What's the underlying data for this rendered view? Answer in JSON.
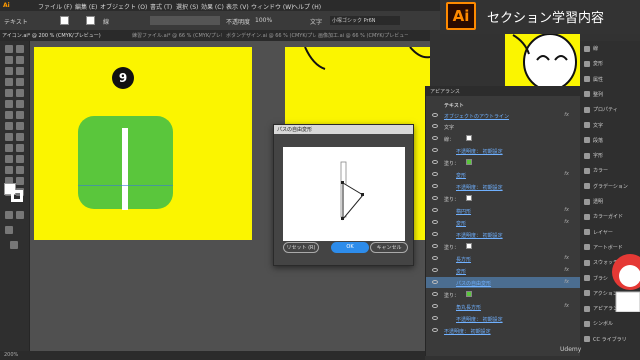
{
  "menu": {
    "items": [
      "ファイル (F)",
      "編集 (E)",
      "オブジェクト (O)",
      "書式 (T)",
      "選択 (S)",
      "効果 (C)",
      "表示 (V)",
      "ウィンドウ (W)",
      "ヘルプ (H)"
    ]
  },
  "control_bar": {
    "object_type": "テキスト",
    "stroke_label": "線",
    "opacity_label": "不透明度",
    "opacity_value": "100%",
    "char_label": "文字",
    "font_value": "小塚ゴシック Pr6N"
  },
  "doc_tabs": [
    "アイコン.ai* @ 200 % (CMYK/プレビュー)",
    "練習ファイル.ai* @ 66 % (CMYK/プレビュー)",
    "ボタンデザイン.ai @ 66 % (CMYK/プレビュー)",
    "画像加工.ai @ 66 % (CMYK/プレビュー)"
  ],
  "artboard": {
    "badge_number": "9"
  },
  "dialog": {
    "title": "パスの自由変形",
    "reset_label": "リセット (R)",
    "ok_label": "OK",
    "cancel_label": "キャンセル"
  },
  "appearance_panel": {
    "title": "アピアランス",
    "object_label": "テキスト",
    "object_link": "オブジェクトのアウトライン",
    "rows": [
      {
        "label": "文字",
        "link": false,
        "indent": 18
      },
      {
        "label": "線：",
        "link": false,
        "indent": 18
      },
      {
        "label": "不透明度： 初期設定",
        "link": true,
        "indent": 30
      },
      {
        "label": "塗り：",
        "link": false,
        "indent": 18
      },
      {
        "label": "変形",
        "link": true,
        "indent": 30
      },
      {
        "label": "不透明度： 初期設定",
        "link": true,
        "indent": 30
      },
      {
        "label": "塗り：",
        "link": false,
        "indent": 18
      },
      {
        "label": "楕円形",
        "link": true,
        "indent": 30
      },
      {
        "label": "変形",
        "link": true,
        "indent": 30
      },
      {
        "label": "不透明度： 初期設定",
        "link": true,
        "indent": 30
      },
      {
        "label": "塗り：",
        "link": false,
        "indent": 18
      },
      {
        "label": "長方形",
        "link": true,
        "indent": 30
      },
      {
        "label": "変形",
        "link": true,
        "indent": 30
      },
      {
        "label": "パスの自由変形",
        "link": true,
        "indent": 30
      },
      {
        "label": "塗り：",
        "link": false,
        "indent": 18
      },
      {
        "label": "角丸長方形",
        "link": true,
        "indent": 30
      },
      {
        "label": "不透明度： 初期設定",
        "link": true,
        "indent": 30
      },
      {
        "label": "不透明度： 初期設定",
        "link": true,
        "indent": 18
      }
    ],
    "selected_row": 13,
    "fx_label": "fx"
  },
  "right_panels": [
    {
      "label": "線",
      "icon": "stroke-icon"
    },
    {
      "label": "変形",
      "icon": "transform-icon"
    },
    {
      "label": "属性",
      "icon": "attributes-icon"
    },
    {
      "label": "整列",
      "icon": "align-icon"
    },
    {
      "label": "プロパティ",
      "icon": "properties-icon"
    },
    {
      "label": "文字",
      "icon": "character-icon"
    },
    {
      "label": "段落",
      "icon": "paragraph-icon"
    },
    {
      "label": "字形",
      "icon": "glyphs-icon"
    },
    {
      "label": "カラー",
      "icon": "color-icon"
    },
    {
      "label": "グラデーション",
      "icon": "gradient-icon"
    },
    {
      "label": "透明",
      "icon": "transparency-icon"
    },
    {
      "label": "カラーガイド",
      "icon": "color-guide-icon"
    },
    {
      "label": "レイヤー",
      "icon": "layers-icon"
    },
    {
      "label": "アートボード",
      "icon": "artboards-icon"
    },
    {
      "label": "スウォッチ",
      "icon": "swatches-icon"
    },
    {
      "label": "ブラシ",
      "icon": "brushes-icon"
    },
    {
      "label": "アクション",
      "icon": "actions-icon"
    },
    {
      "label": "アピアランス",
      "icon": "appearance-icon"
    },
    {
      "label": "シンボル",
      "icon": "symbols-icon"
    },
    {
      "label": "CC ライブラリ",
      "icon": "cc-libraries-icon"
    }
  ],
  "banner": {
    "logo": "Ai",
    "text": "セクション学習内容"
  },
  "status": {
    "zoom": "200%"
  },
  "watermark": "Udemy",
  "colors": {
    "artboard": "#fbf500",
    "icon_green": "#5ac63c",
    "ok_button": "#2d8ceb",
    "ai_orange": "#ff8a00"
  }
}
